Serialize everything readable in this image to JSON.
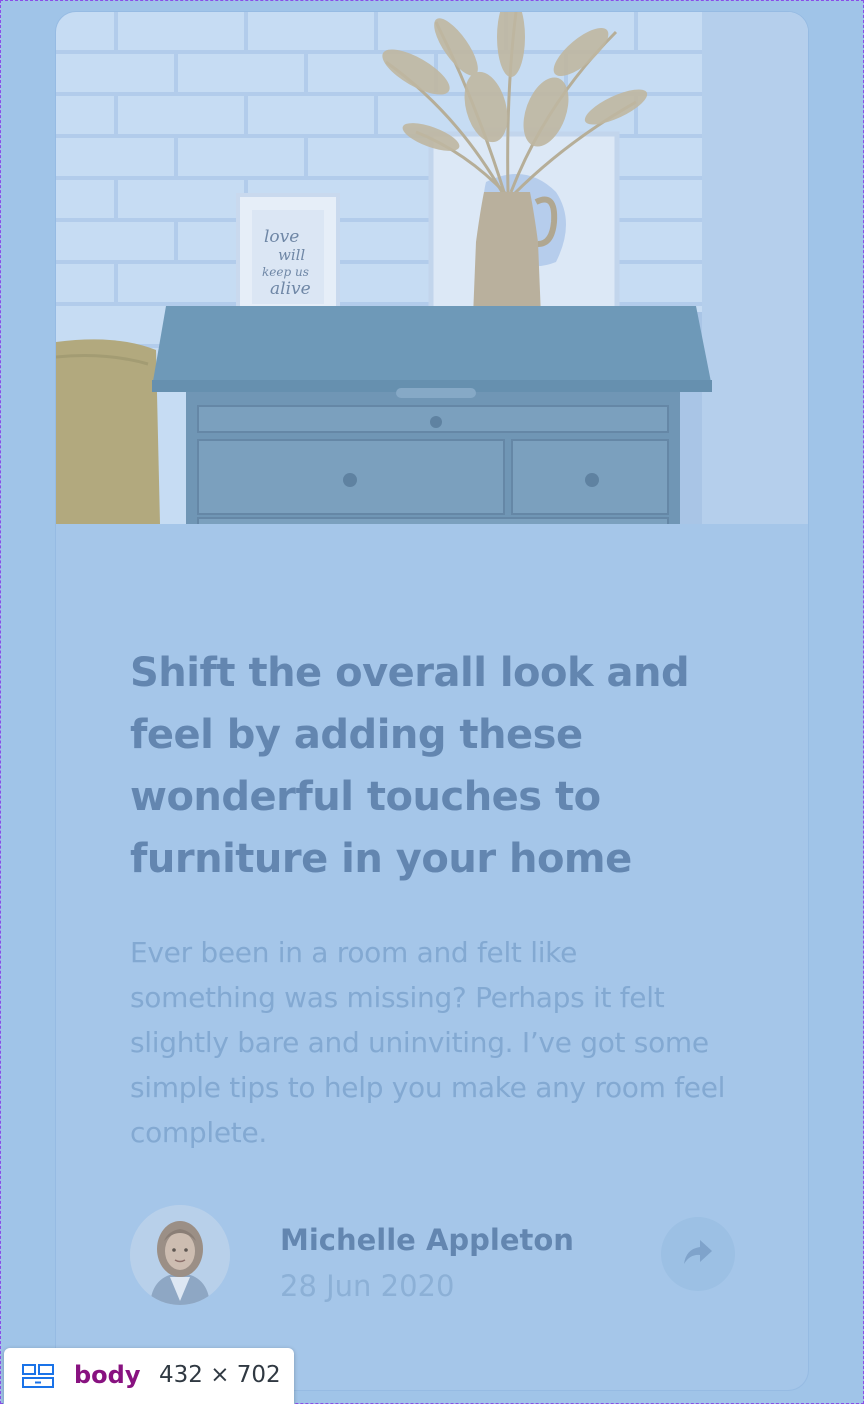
{
  "article": {
    "title": "Shift the overall look and feel by adding these wonderful touches to furniture in your home",
    "description": "Ever been in a room and felt like something was missing? Perhaps it felt slightly bare and uninviting. I’ve got some simple tips to help you make any room feel complete.",
    "hero_frame_text": "love will keep us alive"
  },
  "author": {
    "name": "Michelle Appleton",
    "date": "28 Jun 2020"
  },
  "share": {
    "icon": "share-arrow-icon"
  },
  "devtools": {
    "element": "body",
    "size": "432 × 702"
  },
  "colors": {
    "overlay": "#a0c4e8",
    "title": "#6386b0",
    "body_text": "#83a9d2",
    "element_tag": "#881280"
  }
}
